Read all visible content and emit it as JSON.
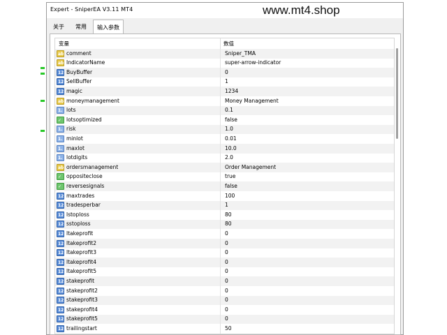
{
  "window": {
    "title": "Expert - SniperEA V3.11 MT4",
    "watermark": "www.mt4.shop"
  },
  "tabs": [
    {
      "label": "关于",
      "active": false
    },
    {
      "label": "常用",
      "active": false
    },
    {
      "label": "输入参数",
      "active": true
    }
  ],
  "table": {
    "headers": {
      "variable": "变量",
      "value": "数值"
    },
    "rows": [
      {
        "icon": "string-icon",
        "name": "comment",
        "value": "Sniper_TMA"
      },
      {
        "icon": "string-icon",
        "name": "IndicatorName",
        "value": "super-arrow-indicator"
      },
      {
        "icon": "integer-icon",
        "name": "BuyBuffer",
        "value": "0"
      },
      {
        "icon": "integer-icon",
        "name": "SellBuffer",
        "value": "1"
      },
      {
        "icon": "integer-icon",
        "name": "magic",
        "value": "1234"
      },
      {
        "icon": "string-icon",
        "name": "moneymanagement",
        "value": "Money Management"
      },
      {
        "icon": "double-icon",
        "name": "lots",
        "value": "0.1"
      },
      {
        "icon": "boolean-icon",
        "name": "lotsoptimized",
        "value": "false"
      },
      {
        "icon": "double-icon",
        "name": "risk",
        "value": "1.0"
      },
      {
        "icon": "double-icon",
        "name": "minlot",
        "value": "0.01"
      },
      {
        "icon": "double-icon",
        "name": "maxlot",
        "value": "10.0"
      },
      {
        "icon": "double-icon",
        "name": "lotdigits",
        "value": "2.0"
      },
      {
        "icon": "string-icon",
        "name": "ordersmanagement",
        "value": "Order Management"
      },
      {
        "icon": "boolean-icon",
        "name": "oppositeclose",
        "value": "true"
      },
      {
        "icon": "boolean-icon",
        "name": "reversesignals",
        "value": "false"
      },
      {
        "icon": "integer-icon",
        "name": "maxtrades",
        "value": "100"
      },
      {
        "icon": "integer-icon",
        "name": "tradesperbar",
        "value": "1"
      },
      {
        "icon": "integer-icon",
        "name": "lstoploss",
        "value": "80"
      },
      {
        "icon": "integer-icon",
        "name": "sstoploss",
        "value": "80"
      },
      {
        "icon": "integer-icon",
        "name": "ltakeprofit",
        "value": "0"
      },
      {
        "icon": "integer-icon",
        "name": "ltakeprofit2",
        "value": "0"
      },
      {
        "icon": "integer-icon",
        "name": "ltakeprofit3",
        "value": "0"
      },
      {
        "icon": "integer-icon",
        "name": "ltakeprofit4",
        "value": "0"
      },
      {
        "icon": "integer-icon",
        "name": "ltakeprofit5",
        "value": "0"
      },
      {
        "icon": "integer-icon",
        "name": "stakeprofit",
        "value": "0"
      },
      {
        "icon": "integer-icon",
        "name": "stakeprofit2",
        "value": "0"
      },
      {
        "icon": "integer-icon",
        "name": "stakeprofit3",
        "value": "0"
      },
      {
        "icon": "integer-icon",
        "name": "stakeprofit4",
        "value": "0"
      },
      {
        "icon": "integer-icon",
        "name": "stakeprofit5",
        "value": "0"
      },
      {
        "icon": "integer-icon",
        "name": "trailingstart",
        "value": "50"
      }
    ]
  },
  "colors": {
    "string": "#e8c94a",
    "integer": "#5a8dd8",
    "double": "#8fb4e8",
    "boolean": "#6fc66f",
    "row_alt": "#f2f2f2"
  }
}
